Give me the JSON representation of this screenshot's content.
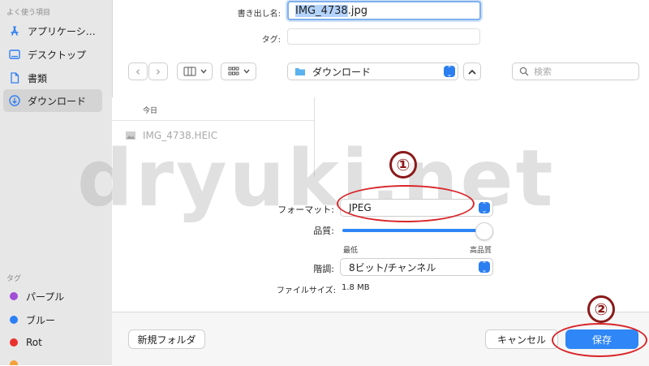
{
  "sidebar": {
    "favorites_heading": "よく使う項目",
    "items": [
      {
        "label": "アプリケーシ…",
        "icon": "app-store-icon"
      },
      {
        "label": "デスクトップ",
        "icon": "desktop-icon"
      },
      {
        "label": "書類",
        "icon": "document-icon"
      },
      {
        "label": "ダウンロード",
        "icon": "download-icon",
        "selected": true
      }
    ],
    "tags_heading": "タグ",
    "tags": [
      {
        "label": "パープル",
        "color": "#a14fd6"
      },
      {
        "label": "ブルー",
        "color": "#2d7ff5"
      },
      {
        "label": "Rot",
        "color": "#e8322e"
      },
      {
        "label": "",
        "color": "#f3a13a"
      }
    ]
  },
  "save_form": {
    "name_label": "書き出し名:",
    "name_value_selected": "IMG_4738",
    "name_value_ext": ".jpg",
    "tags_label": "タグ:",
    "tags_value": ""
  },
  "toolbar": {
    "back_glyph": "‹",
    "forward_glyph": "›",
    "location": "ダウンロード",
    "search_placeholder": "検索"
  },
  "file_list": {
    "section_header": "今日",
    "files": [
      {
        "name": "IMG_4738.HEIC",
        "icon": "image-file-icon"
      }
    ]
  },
  "options": {
    "format_label": "フォーマット:",
    "format_value": "JPEG",
    "quality_label": "品質:",
    "quality_value": 0.95,
    "quality_min_label": "最低",
    "quality_max_label": "高品質",
    "depth_label": "階調:",
    "depth_value": "8ビット/チャンネル",
    "filesize_label": "ファイルサイズ:",
    "filesize_value": "1.8 MB"
  },
  "bottom_bar": {
    "new_folder_label": "新規フォルダ",
    "cancel_label": "キャンセル",
    "save_label": "保存"
  },
  "annotations": {
    "marker1": "①",
    "marker2": "②",
    "watermark": "dryuki.net",
    "ring_color": "#d8262a",
    "marker_color": "#8b1a1a"
  }
}
